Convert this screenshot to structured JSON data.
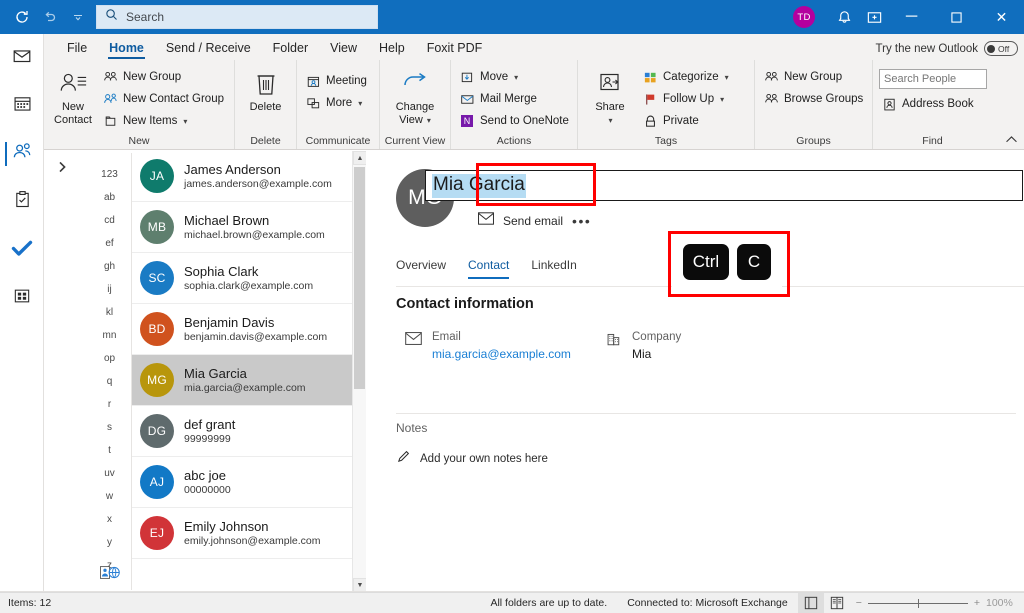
{
  "titlebar": {
    "refresh_icon": "refresh-icon",
    "undo_icon": "undo-icon",
    "customize_icon": "chevron-down-icon",
    "search_placeholder": "Search",
    "search_icon": "search-icon",
    "account_initials": "TD",
    "account_color": "#b4009e",
    "notification_icon": "bell-icon",
    "meeting_icon": "meeting-now-icon",
    "minimize": "─",
    "maximize": "☐",
    "close": "✕",
    "bg_color": "#106ebe"
  },
  "menubar": {
    "tabs": [
      {
        "label": "File",
        "active": false
      },
      {
        "label": "Home",
        "active": true
      },
      {
        "label": "Send / Receive",
        "active": false
      },
      {
        "label": "Folder",
        "active": false
      },
      {
        "label": "View",
        "active": false
      },
      {
        "label": "Help",
        "active": false
      },
      {
        "label": "Foxit PDF",
        "active": false
      }
    ],
    "new_outlook_label": "Try the new Outlook",
    "new_outlook_state": "Off"
  },
  "ribbon": {
    "collapse_icon": "chevron-up-icon",
    "groups": [
      {
        "name": "New",
        "big": {
          "label": "New\nContact",
          "icon": "new-contact-icon"
        },
        "items": [
          {
            "label": "New Group",
            "icon": "new-group-icon",
            "chevron": false
          },
          {
            "label": "New Contact Group",
            "icon": "new-contact-group-icon",
            "chevron": false
          },
          {
            "label": "New Items",
            "icon": "new-items-icon",
            "chevron": true
          }
        ]
      },
      {
        "name": "Delete",
        "big": {
          "label": "Delete",
          "icon": "trash-icon"
        },
        "items": []
      },
      {
        "name": "Communicate",
        "big": null,
        "items": [
          {
            "label": "Meeting",
            "icon": "meeting-icon",
            "chevron": false
          },
          {
            "label": "More",
            "icon": "more-icon",
            "chevron": true
          }
        ]
      },
      {
        "name": "Current View",
        "big": {
          "label": "Change\nView",
          "icon": "change-view-icon",
          "chevron": true
        },
        "items": []
      },
      {
        "name": "Actions",
        "big": null,
        "items": [
          {
            "label": "Move",
            "icon": "move-icon",
            "chevron": true
          },
          {
            "label": "Mail Merge",
            "icon": "mail-merge-icon",
            "chevron": false
          },
          {
            "label": "Send to OneNote",
            "icon": "onenote-icon",
            "chevron": false
          }
        ]
      },
      {
        "name": "Tags",
        "big": {
          "label": "Share",
          "icon": "share-icon",
          "chevron": true
        },
        "items": [
          {
            "label": "Categorize",
            "icon": "categorize-icon",
            "chevron": true
          },
          {
            "label": "Follow Up",
            "icon": "follow-up-icon",
            "chevron": true
          },
          {
            "label": "Private",
            "icon": "private-lock-icon",
            "chevron": false
          }
        ]
      },
      {
        "name": "Groups",
        "big": null,
        "items": [
          {
            "label": "New Group",
            "icon": "new-group-icon",
            "chevron": false
          },
          {
            "label": "Browse Groups",
            "icon": "browse-groups-icon",
            "chevron": false
          }
        ]
      },
      {
        "name": "Find",
        "big": null,
        "search_placeholder": "Search People",
        "items": [
          {
            "label": "Address Book",
            "icon": "address-book-icon",
            "chevron": false
          }
        ]
      }
    ]
  },
  "navrail": {
    "items": [
      {
        "name": "mail",
        "icon": "mail-icon",
        "selected": false
      },
      {
        "name": "calendar",
        "icon": "calendar-icon",
        "selected": false
      },
      {
        "name": "people",
        "icon": "people-icon",
        "selected": true
      },
      {
        "name": "tasks",
        "icon": "tasks-clipboard-icon",
        "selected": false
      },
      {
        "name": "todo",
        "icon": "check-icon",
        "selected": false
      },
      {
        "name": "more-apps",
        "icon": "apps-grid-icon",
        "selected": false
      }
    ]
  },
  "listpane": {
    "expander_icon": "chevron-right-icon",
    "alpha_index": [
      "123",
      "ab",
      "cd",
      "ef",
      "gh",
      "ij",
      "kl",
      "mn",
      "op",
      "q",
      "r",
      "s",
      "t",
      "uv",
      "w",
      "x",
      "y",
      "z"
    ],
    "alpha_bottom_icon": "contacts-globe-icon",
    "scroll_up_icon": "caret-up-icon",
    "scroll_down_icon": "caret-down-icon",
    "contacts": [
      {
        "initials": "JA",
        "name": "James Anderson",
        "sub": "james.anderson@example.com",
        "color": "#0f7b6c",
        "selected": false
      },
      {
        "initials": "MB",
        "name": "Michael Brown",
        "sub": "michael.brown@example.com",
        "color": "#5e7f6e",
        "selected": false
      },
      {
        "initials": "SC",
        "name": "Sophia Clark",
        "sub": "sophia.clark@example.com",
        "color": "#1a7bc4",
        "selected": false
      },
      {
        "initials": "BD",
        "name": "Benjamin Davis",
        "sub": "benjamin.davis@example.com",
        "color": "#d0521e",
        "selected": false
      },
      {
        "initials": "MG",
        "name": "Mia Garcia",
        "sub": "mia.garcia@example.com",
        "color": "#b8960c",
        "selected": true
      },
      {
        "initials": "DG",
        "name": "def grant",
        "sub": "99999999",
        "color": "#5f6b6d",
        "selected": false
      },
      {
        "initials": "AJ",
        "name": "abc joe",
        "sub": "00000000",
        "color": "#1279c6",
        "selected": false
      },
      {
        "initials": "EJ",
        "name": "Emily Johnson",
        "sub": "emily.johnson@example.com",
        "color": "#d13438",
        "selected": false
      }
    ]
  },
  "card": {
    "avatar_initials": "MG",
    "avatar_color": "#5e5e5e",
    "name_value": "Mia Garcia",
    "send_email_label": "Send email",
    "send_email_icon": "envelope-icon",
    "more_icon": "ellipsis-icon",
    "tabs": [
      {
        "label": "Overview",
        "active": false
      },
      {
        "label": "Contact",
        "active": true
      },
      {
        "label": "LinkedIn",
        "active": false
      }
    ],
    "section_title": "Contact information",
    "fields": [
      {
        "icon": "envelope-icon",
        "label": "Email",
        "value": "mia.garcia@example.com",
        "is_link": true
      },
      {
        "icon": "company-building-icon",
        "label": "Company",
        "value": "Mia",
        "is_link": false
      }
    ],
    "notes_label": "Notes",
    "notes_placeholder": "Add your own notes here",
    "notes_icon": "pencil-icon"
  },
  "annotations": {
    "key1": "Ctrl",
    "key2": "C",
    "box_color": "#ff0000"
  },
  "statusbar": {
    "items_label": "Items: 12",
    "sync_status": "All folders are up to date.",
    "connection": "Connected to: Microsoft Exchange",
    "normal_view_icon": "normal-view-icon",
    "reading_view_icon": "reading-view-icon",
    "zoom_out": "−",
    "zoom_in": "+",
    "zoom_level": "100%"
  }
}
